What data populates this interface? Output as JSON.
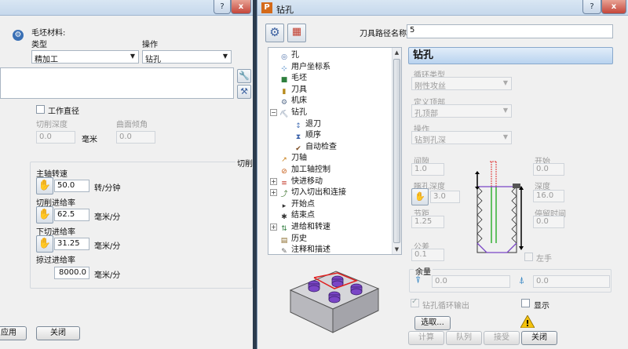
{
  "left": {
    "title_buttons": {
      "help": "?",
      "close": "x"
    },
    "stock_material": "毛坯材料:",
    "type_label": "类型",
    "operation_label": "操作",
    "type_value": "精加工",
    "operation_value": "钻孔",
    "tool_diameter": {
      "label": "工作直径",
      "cut_depth": "切削深度",
      "cut_depth_unit": "毫米",
      "cut_depth_value": "0.0",
      "curve_angle": "曲面倾角",
      "curve_angle_value": "0.0"
    },
    "cutting": {
      "title": "切削条件",
      "spindle_label": "主轴转速",
      "spindle_value": "50.0",
      "spindle_unit": "转/分钟",
      "feed_label": "切削进给率",
      "feed_value": "62.5",
      "feed_unit": "毫米/分",
      "plunge_label": "下切进给率",
      "plunge_value": "31.25",
      "plunge_unit": "毫米/分",
      "skim_label": "掠过进给率",
      "skim_value": "8000.0",
      "skim_unit": "毫米/分"
    },
    "buttons": {
      "apply": "应用",
      "close": "关闭"
    }
  },
  "right": {
    "title": "钻孔",
    "title_buttons": {
      "help": "?",
      "close": "x"
    },
    "toolpath_name_label": "刀具路径名称",
    "toolpath_name_value": "5",
    "tree": [
      {
        "label": "孔",
        "icon": "hole-icon",
        "color": "#4a6ea8"
      },
      {
        "label": "用户坐标系",
        "icon": "workplane-icon",
        "color": "#3a7ec2"
      },
      {
        "label": "毛坯",
        "icon": "block-icon",
        "color": "#2e7f3e"
      },
      {
        "label": "刀具",
        "icon": "tool-icon",
        "color": "#b78a1c"
      },
      {
        "label": "机床",
        "icon": "machine-icon",
        "color": "#556b8a"
      },
      {
        "label": "钻孔",
        "icon": "drilling-icon",
        "color": "#6b7f9b"
      },
      {
        "label": "退刀",
        "icon": "retract-icon",
        "color": "#4b74b8"
      },
      {
        "label": "顺序",
        "icon": "order-icon",
        "color": "#3960a8"
      },
      {
        "label": "自动检查",
        "icon": "auto-verify-icon",
        "color": "#7b4a20"
      },
      {
        "label": "刀轴",
        "icon": "tool-axis-icon",
        "color": "#c67b12"
      },
      {
        "label": "加工轴控制",
        "icon": "axis-control-icon",
        "color": "#c65a12"
      },
      {
        "label": "快进移动",
        "icon": "rapid-move-icon",
        "color": "#c23a2a"
      },
      {
        "label": "切入切出和连接",
        "icon": "lead-link-icon",
        "color": "#4a7d3c"
      },
      {
        "label": "开始点",
        "icon": "start-point-icon",
        "color": "#333333"
      },
      {
        "label": "结束点",
        "icon": "end-point-icon",
        "color": "#333333"
      },
      {
        "label": "进给和转速",
        "icon": "feeds-speeds-icon",
        "color": "#2f7d3f"
      },
      {
        "label": "历史",
        "icon": "history-icon",
        "color": "#8a6a2a"
      },
      {
        "label": "注释和描述",
        "icon": "notes-icon",
        "color": "#666666"
      }
    ],
    "panel_title": "钻孔",
    "cycle_type_label": "循环类型",
    "cycle_type_value": "刚性攻丝",
    "define_top_label": "定义顶部",
    "define_top_value": "孔顶部",
    "operation_label": "操作",
    "operation_value": "钻到孔深",
    "clearance_label": "间隙",
    "clearance_value": "1.0",
    "peck_depth_label": "啄孔深度",
    "peck_depth_value": "3.0",
    "pitch_label": "节距",
    "pitch_value": "1.25",
    "tolerance_label": "公差",
    "tolerance_value": "0.1",
    "start_label": "开始",
    "start_value": "0.0",
    "depth_label": "深度",
    "depth_value": "16.0",
    "dwell_label": "停留时间",
    "dwell_value": "0.0",
    "left_hand_label": "左手",
    "allowance_title": "余量",
    "allowance_axial_value": "0.0",
    "allowance_radial_value": "0.0",
    "cycle_output_label": "钻孔循环输出",
    "display_label": "显示",
    "select_button": "选取...",
    "compute_button": "计算",
    "queue_button": "队列",
    "accept_button": "接受",
    "close_button": "关闭"
  }
}
